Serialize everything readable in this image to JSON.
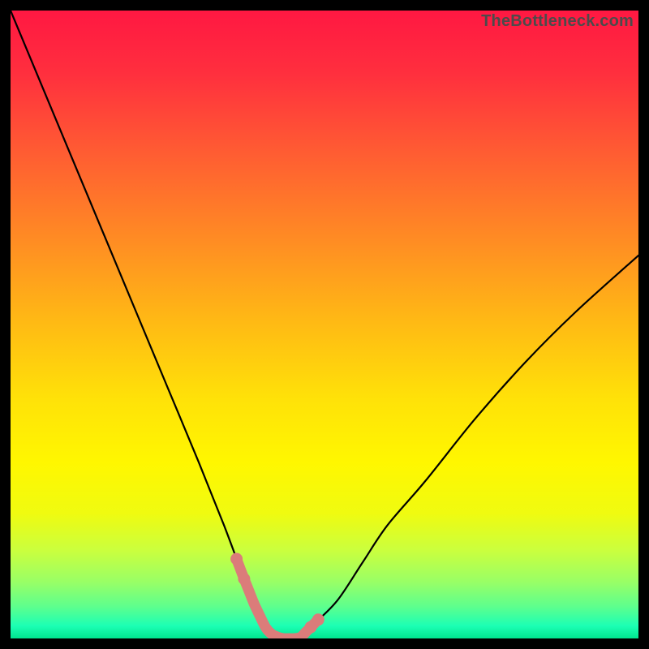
{
  "watermark": "TheBottleneck.com",
  "colors": {
    "black": "#000000",
    "curve": "#000000",
    "highlight": "#db7c7a",
    "gradient_stops": [
      {
        "offset": 0.0,
        "color": "#ff1842"
      },
      {
        "offset": 0.1,
        "color": "#ff2f3e"
      },
      {
        "offset": 0.22,
        "color": "#ff5a33"
      },
      {
        "offset": 0.36,
        "color": "#ff8a24"
      },
      {
        "offset": 0.5,
        "color": "#ffbb14"
      },
      {
        "offset": 0.62,
        "color": "#ffe208"
      },
      {
        "offset": 0.72,
        "color": "#fff700"
      },
      {
        "offset": 0.8,
        "color": "#f0fb10"
      },
      {
        "offset": 0.86,
        "color": "#caff3e"
      },
      {
        "offset": 0.91,
        "color": "#99ff66"
      },
      {
        "offset": 0.95,
        "color": "#5cff8e"
      },
      {
        "offset": 0.98,
        "color": "#1cffb4"
      },
      {
        "offset": 1.0,
        "color": "#00e58f"
      }
    ]
  },
  "chart_data": {
    "type": "line",
    "title": "",
    "xlabel": "",
    "ylabel": "",
    "xlim": [
      0,
      100
    ],
    "ylim": [
      0,
      100
    ],
    "series": [
      {
        "name": "bottleneck-curve",
        "x": [
          0,
          5,
          10,
          15,
          20,
          25,
          30,
          34,
          37,
          39,
          41,
          43,
          46,
          48,
          52,
          56,
          60,
          66,
          74,
          82,
          90,
          100
        ],
        "y": [
          100,
          88,
          76,
          64,
          52,
          40,
          28,
          18,
          10,
          5,
          1,
          0,
          0,
          2,
          6,
          12,
          18,
          25,
          35,
          44,
          52,
          61
        ]
      }
    ],
    "highlight_segment": {
      "series": "bottleneck-curve",
      "x_start": 36,
      "x_end": 49,
      "style": "thick-dotted",
      "color": "#db7c7a"
    },
    "annotations": [
      {
        "text": "TheBottleneck.com",
        "position": "top-right",
        "role": "watermark"
      }
    ]
  }
}
